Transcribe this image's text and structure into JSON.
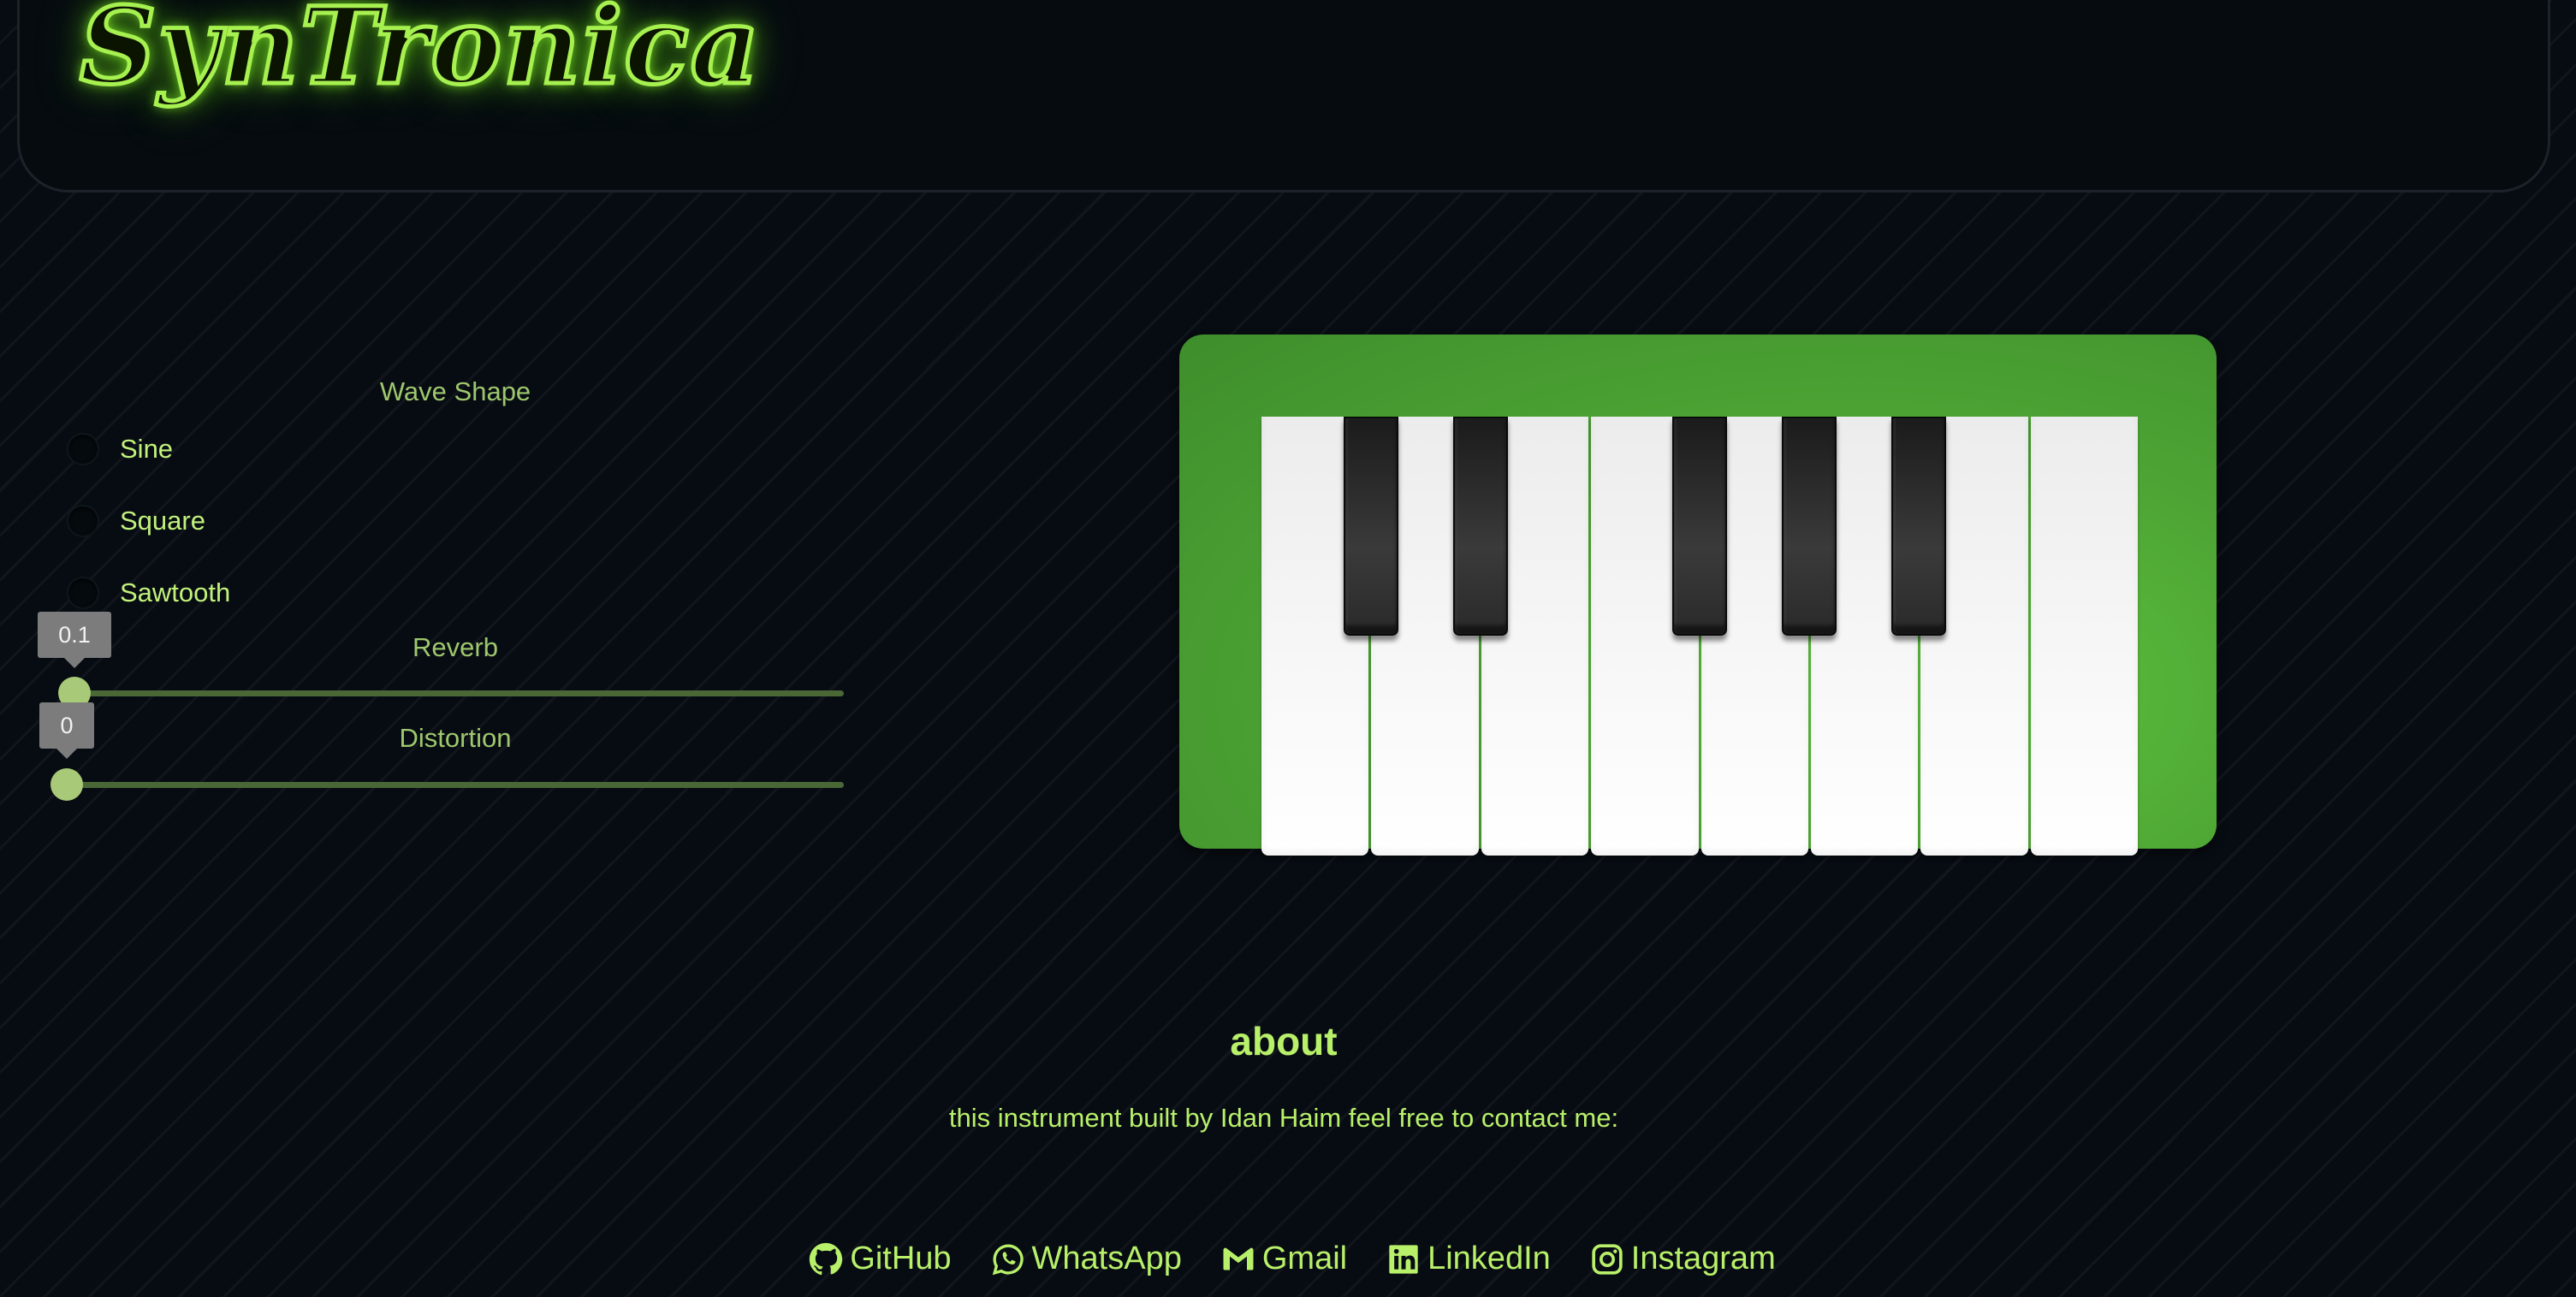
{
  "header": {
    "logo_text": "SynTronica"
  },
  "wave_shape": {
    "title": "Wave Shape",
    "options": [
      {
        "label": "Sine",
        "selected": false
      },
      {
        "label": "Square",
        "selected": false
      },
      {
        "label": "Sawtooth",
        "selected": false
      }
    ]
  },
  "reverb": {
    "label": "Reverb",
    "value": "0.1",
    "min": 0,
    "max": 10
  },
  "distortion": {
    "label": "Distortion",
    "value": "0",
    "min": 0,
    "max": 10
  },
  "keyboard": {
    "white_key_count": 8,
    "black_key_count": 5,
    "body_color": "#4ea534"
  },
  "about": {
    "title": "about",
    "text": "this instrument built by Idan Haim feel free to contact me:"
  },
  "social": [
    {
      "label": "GitHub",
      "icon": "github-icon"
    },
    {
      "label": "WhatsApp",
      "icon": "whatsapp-icon"
    },
    {
      "label": "Gmail",
      "icon": "gmail-icon"
    },
    {
      "label": "LinkedIn",
      "icon": "linkedin-icon"
    },
    {
      "label": "Instagram",
      "icon": "instagram-icon"
    }
  ],
  "colors": {
    "accent": "#b8f06a",
    "background": "#070c12",
    "slider_track": "#4a6836",
    "slider_thumb": "#a8c977"
  }
}
